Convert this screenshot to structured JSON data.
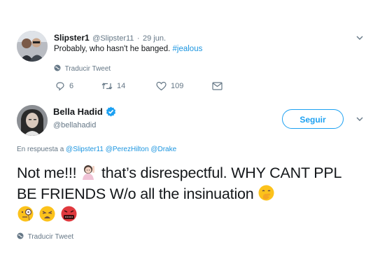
{
  "reply_tweet": {
    "display_name": "Slipster1",
    "handle": "@Slipster11",
    "separator": "·",
    "date": "29 jun.",
    "text": "Probably,  who hasn't he banged.",
    "hashtag": "#jealous",
    "translate_label": "Traducir Tweet",
    "replies_count": "6",
    "retweets_count": "14",
    "likes_count": "109"
  },
  "main_tweet": {
    "display_name": "Bella Hadid",
    "handle": "@bellahadid",
    "verified": true,
    "follow_label": "Seguir",
    "reply_context_prefix": "En respuesta a",
    "reply_mentions": [
      "@Slipster11",
      "@PerezHilton",
      "@Drake"
    ],
    "text_part1": "Not me!!!",
    "text_part2": "that’s disrespectful. WHY CANT PPL BE FRIENDS W/o all the insinuation",
    "translate_label": "Traducir Tweet",
    "emoji_names": [
      "woman-raising-hand-emoji",
      "hand-over-mouth-emoji",
      "monocle-face-emoji",
      "weary-face-emoji",
      "cursing-face-emoji"
    ]
  },
  "colors": {
    "accent": "#1da1f2",
    "link": "#1b95e0",
    "muted": "#657786",
    "text": "#14171a"
  }
}
